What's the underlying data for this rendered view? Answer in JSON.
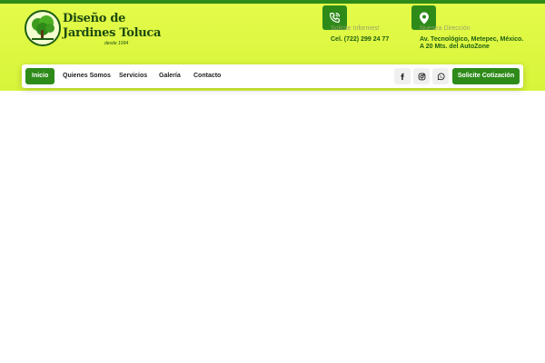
{
  "brand": {
    "line1": "Diseño de",
    "line2": "Jardines Toluca",
    "since": "desde 1994"
  },
  "contact": {
    "phone_label": "Solicite Informes!",
    "phone_value": "Cel. (722) 299 24 77",
    "address_label": "Nuestra Dirección",
    "address_line1": "Av. Tecnológico, Metepec, México.",
    "address_line2": "A 20 Mts. del AutoZone"
  },
  "nav": {
    "items": [
      "Inicio",
      "Quienes Somos",
      "Servicios",
      "Galería",
      "Contacto"
    ],
    "active": "Inicio"
  },
  "social": {
    "facebook": "facebook-icon",
    "instagram": "instagram-icon",
    "whatsapp": "whatsapp-icon"
  },
  "cta": {
    "label": "Solicite Cotización"
  },
  "colors": {
    "accent": "#2e8b1a",
    "header_bg": "#e4fb4a"
  }
}
